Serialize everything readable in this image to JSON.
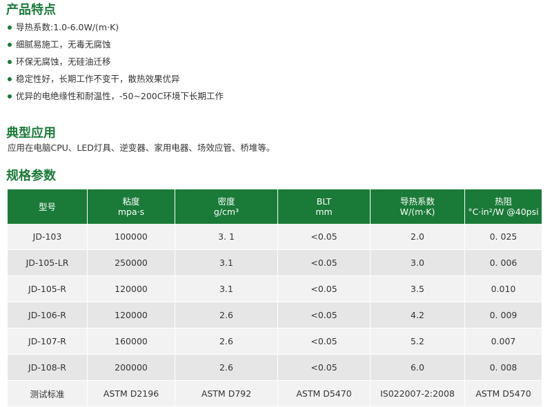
{
  "features": {
    "title": "产品特点",
    "items": [
      "导热系数:1.0-6.0W/(m·K)",
      "细腻易施工，无毒无腐蚀",
      "环保无腐蚀，无硅油迁移",
      "稳定性好，长期工作不变干，散热效果优异",
      "优异的电绝缘性和耐温性，-50~200C环境下长期工作"
    ]
  },
  "applications": {
    "title": "典型应用",
    "text": "应用在电脑CPU、LED灯具、逆变器、家用电器、场效应管、桥堆等。"
  },
  "specs": {
    "title": "规格参数",
    "headers": [
      {
        "main": "型号",
        "sub": ""
      },
      {
        "main": "粘度",
        "sub": "mpa·s"
      },
      {
        "main": "密度",
        "sub": "g/cm³"
      },
      {
        "main": "BLT",
        "sub": "mm"
      },
      {
        "main": "导热系数",
        "sub": "W/(m·K)"
      },
      {
        "main": "热阻",
        "sub": "°C·in²/W @40psi"
      }
    ],
    "rows": [
      [
        "JD-103",
        "100000",
        "3. 1",
        "<0.05",
        "2.0",
        "0. 025"
      ],
      [
        "JD-105-LR",
        "250000",
        "3.1",
        "<0.05",
        "3.0",
        "0. 006"
      ],
      [
        "JD-105-R",
        "120000",
        "3.1",
        "<0.05",
        "3.5",
        "0.010"
      ],
      [
        "JD-106-R",
        "120000",
        "2.6",
        "<0.05",
        "4.2",
        "0. 009"
      ],
      [
        "JD-107-R",
        "160000",
        "2.6",
        "<0.05",
        "5.2",
        "0.007"
      ],
      [
        "JD-108-R",
        "200000",
        "2.6",
        "<0.05",
        "6.0",
        "0. 008"
      ],
      [
        "测试标准",
        "ASTM D2196",
        "ASTM D792",
        "ASTM D5470",
        "IS022007-2:2008",
        "ASTM D5470"
      ]
    ]
  },
  "colors": {
    "accent": "#1a7a38",
    "row_light": "#f2f2f2",
    "row_dark": "#e6e6e6"
  }
}
